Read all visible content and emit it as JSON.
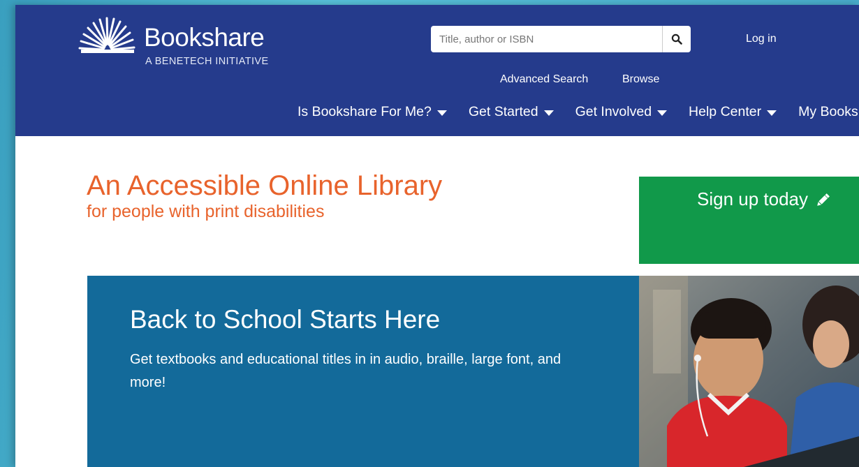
{
  "brand": {
    "name": "Bookshare",
    "tagline": "A BENETECH INITIATIVE"
  },
  "search": {
    "placeholder": "Title, author or ISBN",
    "icon": "search-icon"
  },
  "header_links": {
    "login": "Log in",
    "advanced_search": "Advanced Search",
    "browse": "Browse"
  },
  "nav": [
    {
      "label": "Is Bookshare For Me?"
    },
    {
      "label": "Get Started"
    },
    {
      "label": "Get Involved"
    },
    {
      "label": "Help Center"
    },
    {
      "label": "My Bookshare"
    }
  ],
  "hero": {
    "title": "An Accessible Online Library",
    "subtitle": "for people with print disabilities"
  },
  "signup": {
    "label": "Sign up today",
    "icon": "pencil-icon"
  },
  "banner": {
    "title": "Back to School Starts Here",
    "text": "Get textbooks and educational titles in in audio, braille, large font, and more!"
  },
  "colors": {
    "header_bg": "#253b8c",
    "accent_orange": "#e8632c",
    "signup_green": "#11994a",
    "banner_blue": "#136a9a"
  }
}
